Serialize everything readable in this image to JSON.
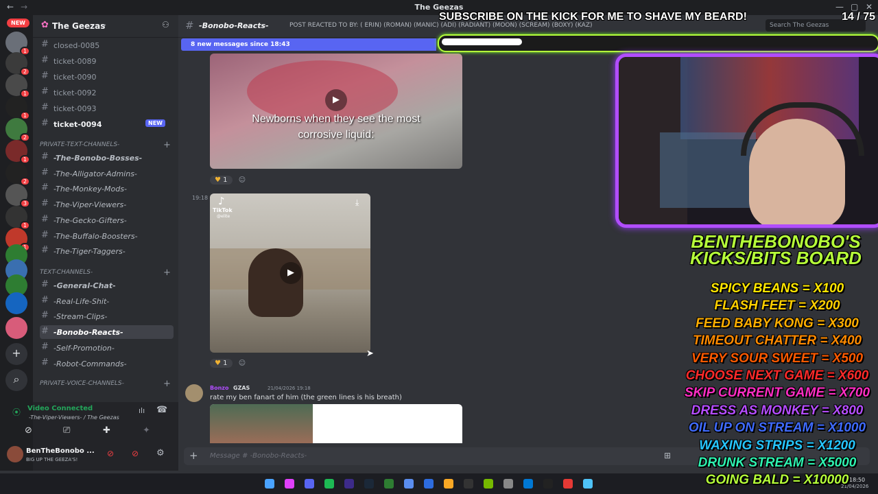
{
  "window": {
    "title": "The Geezas"
  },
  "server": {
    "name": "The Geezas"
  },
  "rail": {
    "new_label": "NEW",
    "badges": [
      "1",
      "2",
      "1",
      "1",
      "2",
      "1",
      "2",
      "3",
      "1",
      "1"
    ]
  },
  "channels": [
    {
      "label": "closed-0085"
    },
    {
      "label": "ticket-0089"
    },
    {
      "label": "ticket-0090"
    },
    {
      "label": "ticket-0092"
    },
    {
      "label": "ticket-0093"
    },
    {
      "label": "ticket-0094",
      "badge": "NEW"
    }
  ],
  "categories": {
    "private_text": "PRIVATE-TEXT-CHANNELS-",
    "text": "TEXT-CHANNELS-",
    "private_voice": "PRIVATE-VOICE-CHANNELS-"
  },
  "private_channels": [
    {
      "label": "-The-Bonobo-Bosses-"
    },
    {
      "label": "-The-Alligator-Admins-"
    },
    {
      "label": "-The-Monkey-Mods-"
    },
    {
      "label": "-The-Viper-Viewers-"
    },
    {
      "label": "-The-Gecko-Gifters-"
    },
    {
      "label": "-The-Buffalo-Boosters-"
    },
    {
      "label": "-The-Tiger-Taggers-"
    }
  ],
  "text_channels": [
    {
      "label": "-General-Chat-"
    },
    {
      "label": "-Real-Life-Shit-"
    },
    {
      "label": "-Stream-Clips-"
    },
    {
      "label": "-Bonobo-Reacts-"
    },
    {
      "label": "-Self-Promotion-"
    },
    {
      "label": "-Robot-Commands-"
    }
  ],
  "voice": {
    "status": "Video Connected",
    "channel": "-The-Viper-Viewers- / The Geezas"
  },
  "user": {
    "name": "BenTheBonobo ...",
    "status": "BIG UP THE GEEZA'S!"
  },
  "header": {
    "channel": "-Bonobo-Reacts-",
    "topic": "POST REACTED TO BY: (   ERIN) (ROMAN) (MANIC) (ADI) (RADIANT) (MOON) (SCREAM) (BOXY) (KAZ)",
    "search_placeholder": "Search The Geezas"
  },
  "new_messages": "8 new messages since 18:43",
  "messages": [
    {
      "caption": "Newborns when they see the most corrosive liquid:",
      "reaction_count": "1"
    },
    {
      "time": "19:18",
      "video_brand": "TikTok",
      "video_handle": "@elite",
      "reaction_count": "1"
    },
    {
      "author": "Bonzo",
      "tag": "GZAS",
      "timestamp": "21/04/2026 19:18",
      "text": "rate my ben fanart of him (the green lines is his breath)"
    }
  ],
  "composer": {
    "placeholder": "Message # -Bonobo-Reacts-"
  },
  "overlay": {
    "banner": "SUBSCRIBE ON THE KICK FOR ME TO SHAVE MY BEARD!",
    "goal_current": 14,
    "goal_total": 75,
    "goal_text": "14 / 75",
    "board_title": "BENTHEBONOBO'S KICKS/BITS BOARD",
    "board_items": [
      {
        "text": "SPICY BEANS = X100",
        "color": "#ffe600"
      },
      {
        "text": "FLASH FEET = X200",
        "color": "#ffd000"
      },
      {
        "text": "FEED BABY KONG = X300",
        "color": "#ffae00"
      },
      {
        "text": "TIMEOUT CHATTER = X400",
        "color": "#ff8a00"
      },
      {
        "text": "VERY SOUR SWEET = X500",
        "color": "#ff5a00"
      },
      {
        "text": "CHOOSE NEXT GAME = X600",
        "color": "#ff2a2a"
      },
      {
        "text": "SKIP CURRENT GAME = X700",
        "color": "#ff2ec4"
      },
      {
        "text": "DRESS AS MONKEY = X800",
        "color": "#b54dff"
      },
      {
        "text": "OIL UP ON STREAM = X1000",
        "color": "#3f6bff"
      },
      {
        "text": "WAXING STRIPS = X1200",
        "color": "#26c6ff"
      },
      {
        "text": "DRUNK STREAM = X5000",
        "color": "#2ef2b0"
      },
      {
        "text": "GOING BALD = X10000",
        "color": "#b6ff3a"
      }
    ]
  },
  "taskbar": {
    "time": "18:50",
    "date": "21/04/2026"
  }
}
